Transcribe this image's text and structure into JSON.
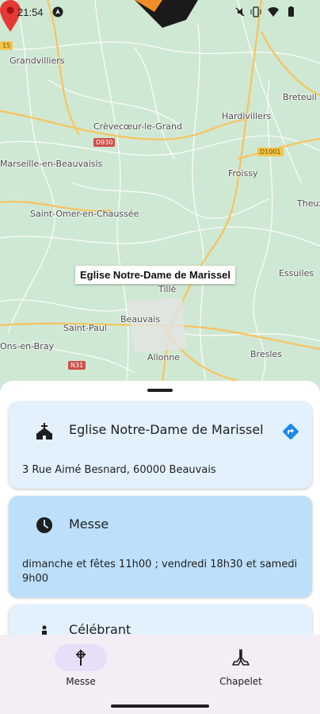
{
  "status_bar": {
    "time": "21:54",
    "icons": [
      "navigation-icon",
      "mute-icon",
      "vibrate-icon",
      "wifi-icon",
      "battery-icon"
    ]
  },
  "map": {
    "places": [
      {
        "name": "Grandvilliers"
      },
      {
        "name": "Breteuil"
      },
      {
        "name": "Hardivillers"
      },
      {
        "name": "Crèvecœur-le-Grand"
      },
      {
        "name": "Marseille-en-Beauvaisis"
      },
      {
        "name": "Froissy"
      },
      {
        "name": "Theux"
      },
      {
        "name": "Saint-Omer-en-Chaussée"
      },
      {
        "name": "Essuiles"
      },
      {
        "name": "Tillé"
      },
      {
        "name": "Beauvais"
      },
      {
        "name": "Saint-Paul"
      },
      {
        "name": "Ons-en-Bray"
      },
      {
        "name": "Allonne"
      },
      {
        "name": "Bresles"
      }
    ],
    "roads": [
      "D930",
      "D1001",
      "N31",
      "15"
    ],
    "callout": "Eglise Notre-Dame de Marissel",
    "colors": {
      "land": "#cfe8d3",
      "road_major": "#f7c35c",
      "road_minor": "#ffffff",
      "pin": "#e53935"
    }
  },
  "sheet": {
    "church_card": {
      "title": "Eglise Notre-Dame de Marissel",
      "address": "3 Rue Aimé Besnard, 60000 Beauvais",
      "icon": "church-icon",
      "action_icon": "directions-icon"
    },
    "mass_card": {
      "title": "Messe",
      "schedule": "dimanche et fêtes 11h00 ; vendredi 18h30 et samedi 9h00",
      "icon": "clock-icon"
    },
    "celebrant_card": {
      "title": "Célébrant",
      "icon": "person-icon"
    }
  },
  "bottom_nav": {
    "items": [
      {
        "label": "Messe",
        "icon": "cross-icon",
        "active": true
      },
      {
        "label": "Chapelet",
        "icon": "praying-hands-icon",
        "active": false
      }
    ]
  },
  "colors": {
    "card_light": "#e3f1fd",
    "card_accent": "#bddffa",
    "nav_bg": "#f3edf6",
    "nav_active_pill": "#e8def8",
    "directions_blue": "#1e88e5"
  }
}
